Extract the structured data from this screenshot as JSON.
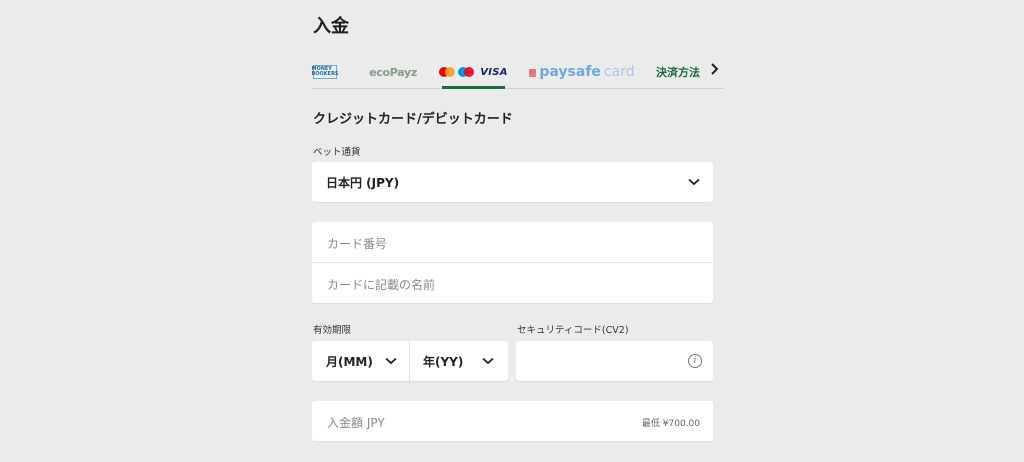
{
  "page": {
    "title": "入金"
  },
  "tabs": {
    "items": [
      {
        "name": "moneybookers",
        "logo_text": "MONEY BOOKERS"
      },
      {
        "name": "ecopayz",
        "logo_text": "ecoPayz"
      },
      {
        "name": "cards",
        "logo_text": "VISA",
        "active": true
      },
      {
        "name": "paysafecard",
        "logo_text_a": "paysafe",
        "logo_text_b": "card"
      },
      {
        "name": "more-methods",
        "label": "決済方法"
      }
    ]
  },
  "section": {
    "title": "クレジットカード/デビットカード"
  },
  "currency": {
    "label": "ベット通貨",
    "value": "日本円 (JPY)"
  },
  "card": {
    "number_placeholder": "カード番号",
    "name_placeholder": "カードに記載の名前"
  },
  "expiry": {
    "label": "有効期限",
    "month": "月(MM)",
    "year": "年(YY)"
  },
  "security": {
    "label": "セキュリティコード(CV2)",
    "info_icon": "i"
  },
  "amount": {
    "placeholder": "入金額 JPY",
    "min_text": "最低 ¥700.00"
  },
  "colors": {
    "accent": "#1d6b3f",
    "background": "#ebebeb"
  }
}
